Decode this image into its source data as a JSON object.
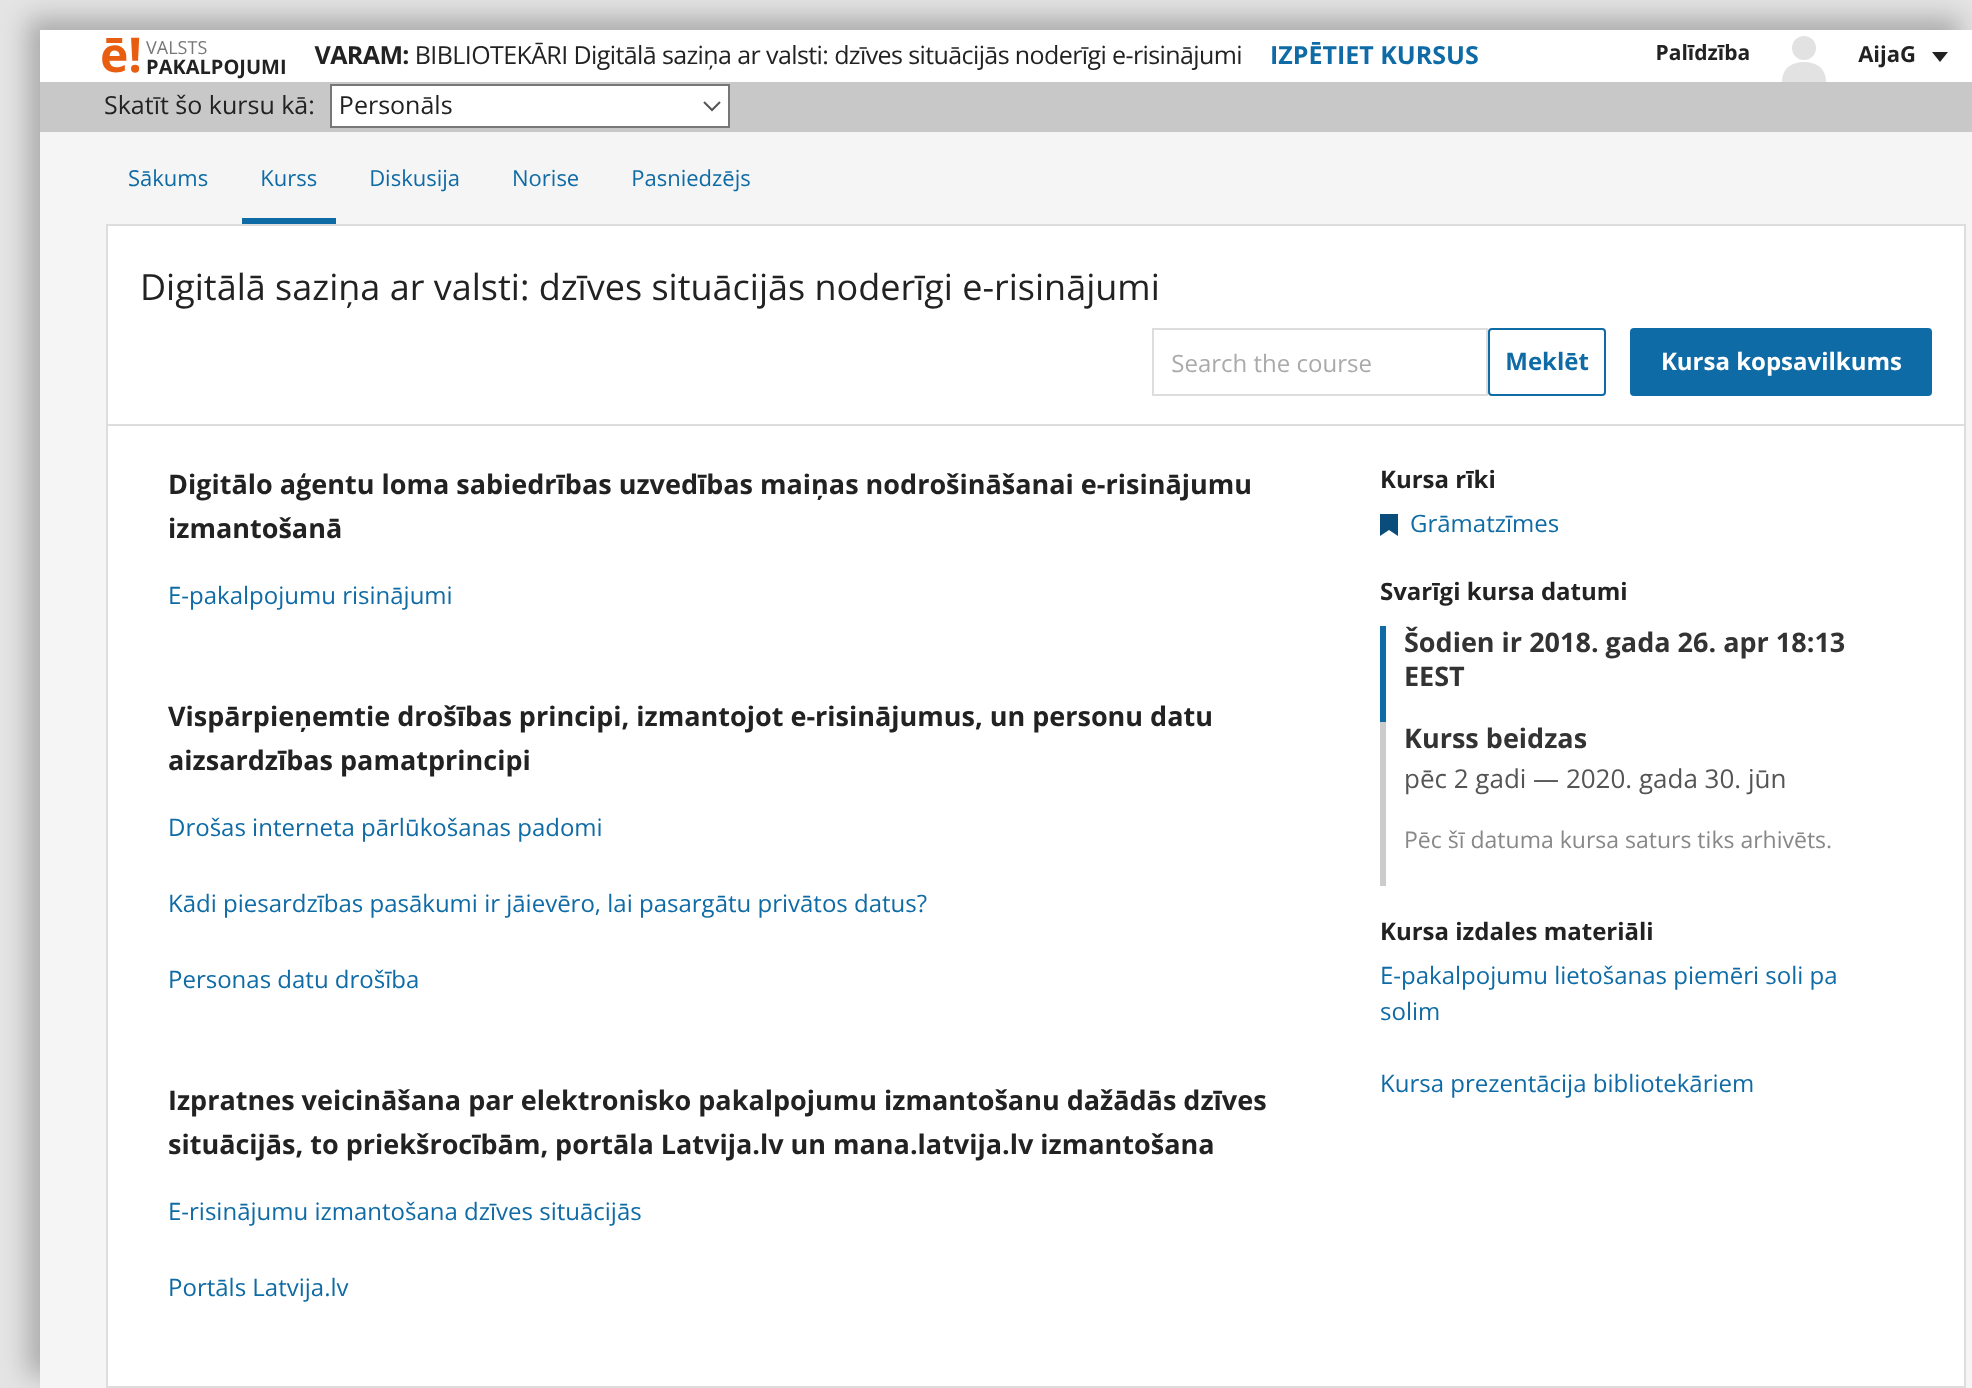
{
  "header": {
    "logo": {
      "mark": "ē!",
      "line1": "VALSTS",
      "line2": "PAKALPOJUMI"
    },
    "course_prefix": "VARAM:",
    "course_title": "BIBLIOTEKĀRI Digitālā saziņa ar valsti: dzīves situācijās noderīgi e-risinājumi",
    "explore": "IZPĒTIET KURSUS",
    "help": "Palīdzība",
    "user": "AijaG"
  },
  "view_as": {
    "label": "Skatīt šo kursu kā:",
    "value": "Personāls"
  },
  "tabs": [
    {
      "label": "Sākums",
      "selected": false
    },
    {
      "label": "Kurss",
      "selected": true
    },
    {
      "label": "Diskusija",
      "selected": false
    },
    {
      "label": "Norise",
      "selected": false
    },
    {
      "label": "Pasniedzējs",
      "selected": false
    }
  ],
  "course": {
    "title": "Digitālā saziņa ar valsti: dzīves situācijās noderīgi e-risinājumi",
    "search_placeholder": "Search the course",
    "search_button": "Meklēt",
    "summary_button": "Kursa kopsavilkums"
  },
  "sections": [
    {
      "title": "Digitālo aģentu loma sabiedrības uzvedības maiņas nodrošināšanai e-risinājumu izmantošanā",
      "links": [
        "E-pakalpojumu risinājumi"
      ]
    },
    {
      "title": "Vispārpieņemtie drošības principi, izmantojot e-risinājumus, un personu datu aizsardzības pamatprincipi",
      "links": [
        "Drošas interneta pārlūkošanas padomi",
        "Kādi piesardzības pasākumi ir jāievēro, lai pasargātu privātos datus?",
        "Personas datu drošība"
      ]
    },
    {
      "title": "Izpratnes veicināšana par elektronisko pakalpojumu izmantošanu dažādās dzīves situācijās, to priekšrocībām, portāla Latvija.lv un mana.latvija.lv izmantošana",
      "links": [
        "E-risinājumu izmantošana dzīves situācijās",
        "Portāls Latvija.lv"
      ]
    }
  ],
  "sidebar": {
    "tools_title": "Kursa rīki",
    "bookmarks": "Grāmatzīmes",
    "dates_title": "Svarīgi kursa datumi",
    "dates": [
      {
        "title": "Šodien ir 2018. gada 26. apr 18:13 EEST",
        "current": true
      },
      {
        "title": "Kurss beidzas",
        "subtitle": "pēc 2 gadi — 2020. gada 30. jūn",
        "note": "Pēc šī datuma kursa saturs tiks arhivēts.",
        "current": false
      }
    ],
    "handouts_title": "Kursa izdales materiāli",
    "handouts": [
      "E-pakalpojumu lietošanas piemēri soli pa solim",
      "Kursa prezentācija bibliotekāriem"
    ]
  }
}
